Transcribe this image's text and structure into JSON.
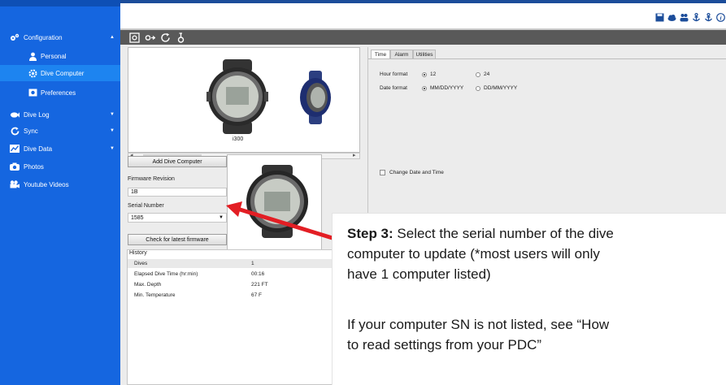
{
  "colors": {
    "sidebar_bg": "#1566e0",
    "sidebar_active": "#1d84f0",
    "toolbar_dark": "#595959",
    "arrow_red": "#e31e24",
    "top_accent": "#1c4d9a"
  },
  "sidebar": {
    "items": [
      {
        "label": "Configuration",
        "icon": "settings-gears-icon",
        "expanded": true
      },
      {
        "label": "Personal",
        "icon": "person-icon"
      },
      {
        "label": "Dive Computer",
        "icon": "gear-icon",
        "active": true
      },
      {
        "label": "Preferences",
        "icon": "preferences-icon"
      },
      {
        "label": "Dive Log",
        "icon": "fish-icon"
      },
      {
        "label": "Sync",
        "icon": "sync-icon"
      },
      {
        "label": "Dive Data",
        "icon": "chart-icon"
      },
      {
        "label": "Photos",
        "icon": "camera-icon"
      },
      {
        "label": "Youtube Videos",
        "icon": "video-icon"
      }
    ]
  },
  "toolbar": {
    "icons": [
      "read-settings-icon",
      "write-settings-icon",
      "refresh-icon",
      "firmware-icon"
    ],
    "top_icons": [
      "save-icon",
      "cloud-icon",
      "users-icon",
      "anchor-icon",
      "anchor-alt-icon",
      "info-icon"
    ]
  },
  "device": {
    "model": "i300",
    "add_button": "Add Dive Computer",
    "firmware_label": "Firmware Revision",
    "firmware_value": "1B",
    "serial_label": "Serial Number",
    "serial_value": "1585",
    "check_button": "Check for latest firmware"
  },
  "history": {
    "title": "History",
    "rows": [
      {
        "label": "Dives",
        "value": "1"
      },
      {
        "label": "Elapsed Dive Time (hr:min)",
        "value": "00:16"
      },
      {
        "label": "Max. Depth",
        "value": "221 FT"
      },
      {
        "label": "Min. Temperature",
        "value": "67 F"
      }
    ]
  },
  "settings": {
    "tabs": [
      "Time",
      "Alarm",
      "Utilities"
    ],
    "active_tab": "Time",
    "hour_format_label": "Hour format",
    "hour_options": [
      "12",
      "24"
    ],
    "hour_selected": "12",
    "date_format_label": "Date format",
    "date_options": [
      "MM/DD/YYYY",
      "DD/MM/YYYY"
    ],
    "date_selected": "MM/DD/YYYY",
    "change_date_label": "Change Date and Time"
  },
  "callout": {
    "step_label": "Step 3:",
    "line1": " Select the serial number of the dive",
    "line2": "computer to update (*most users will only",
    "line3": "have 1 computer listed)",
    "line4": "If your computer SN is not listed, see “How",
    "line5": "to read settings from your PDC”"
  }
}
